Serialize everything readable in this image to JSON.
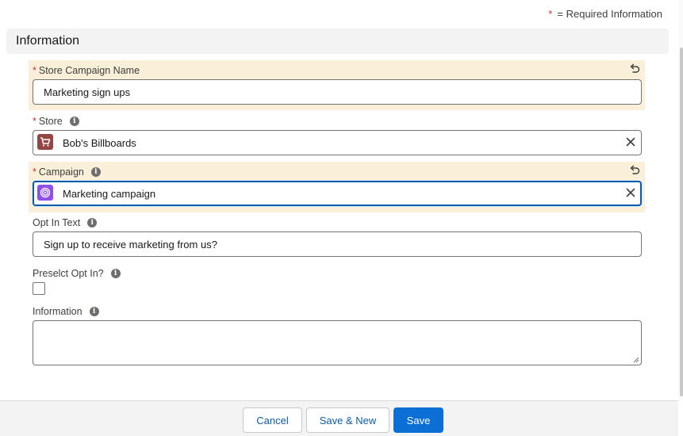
{
  "required_note": {
    "star": "*",
    "text": "= Required Information"
  },
  "section": {
    "title": "Information"
  },
  "fields": {
    "store_campaign_name": {
      "label": "Store Campaign Name",
      "required": "*",
      "value": "Marketing sign ups"
    },
    "store": {
      "label": "Store",
      "required": "*",
      "value": "Bob's Billboards",
      "icon": "store-cart-icon"
    },
    "campaign": {
      "label": "Campaign",
      "required": "*",
      "value": "Marketing campaign",
      "icon": "campaign-target-icon"
    },
    "opt_in_text": {
      "label": "Opt In Text",
      "value": "Sign up to receive marketing from us?"
    },
    "preselect_opt_in": {
      "label": "Preselct Opt In?",
      "checked": false
    },
    "information": {
      "label": "Information",
      "value": ""
    }
  },
  "info_glyph": "i",
  "buttons": {
    "cancel": "Cancel",
    "save_new": "Save & New",
    "save": "Save"
  },
  "colors": {
    "brand": "#0b6fd6",
    "highlight": "#faefd9",
    "required": "#c23934",
    "store_icon": "#944645",
    "campaign_icon": "#9050e9"
  }
}
